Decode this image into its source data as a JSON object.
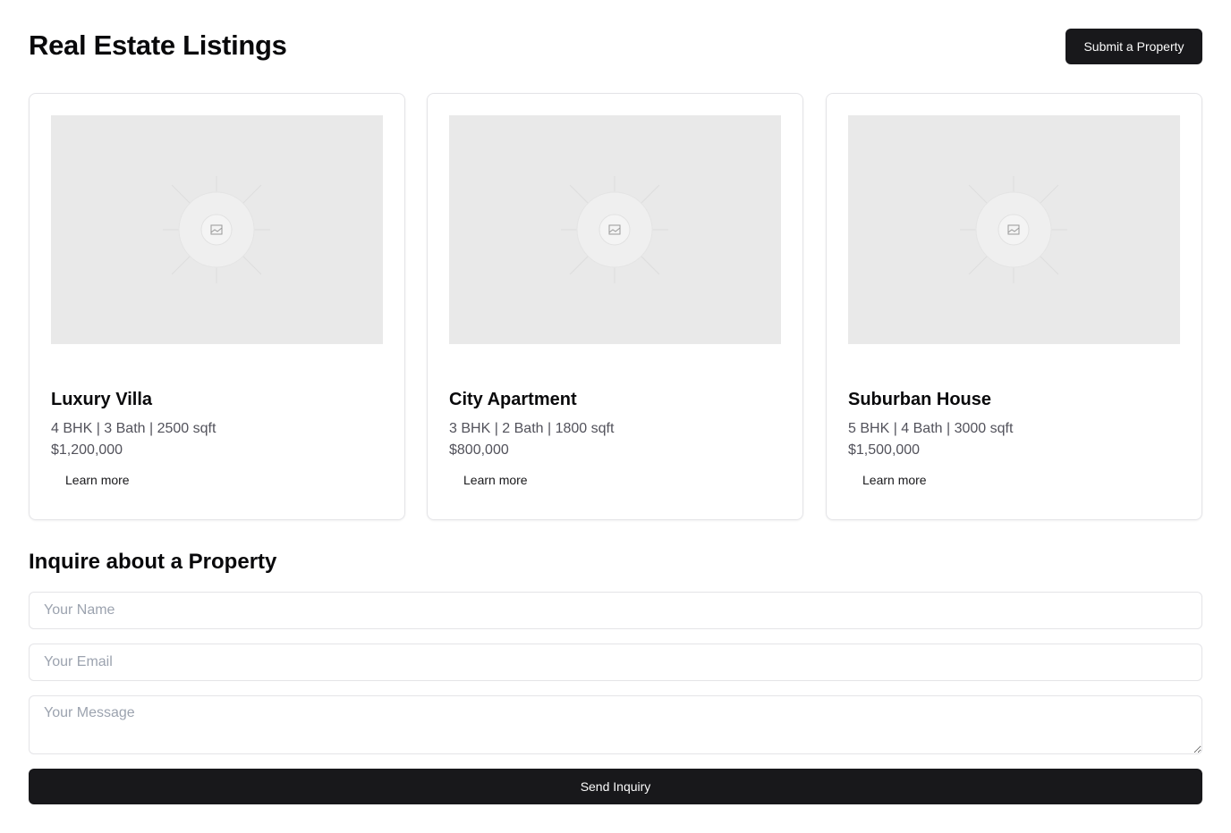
{
  "header": {
    "title": "Real Estate Listings",
    "submit_label": "Submit a Property"
  },
  "listings": [
    {
      "title": "Luxury Villa",
      "specs": "4 BHK | 3 Bath | 2500 sqft",
      "price": "$1,200,000",
      "link": "Learn more"
    },
    {
      "title": "City Apartment",
      "specs": "3 BHK | 2 Bath | 1800 sqft",
      "price": "$800,000",
      "link": "Learn more"
    },
    {
      "title": "Suburban House",
      "specs": "5 BHK | 4 Bath | 3000 sqft",
      "price": "$1,500,000",
      "link": "Learn more"
    }
  ],
  "inquiry": {
    "title": "Inquire about a Property",
    "name_placeholder": "Your Name",
    "email_placeholder": "Your Email",
    "message_placeholder": "Your Message",
    "send_label": "Send Inquiry"
  }
}
